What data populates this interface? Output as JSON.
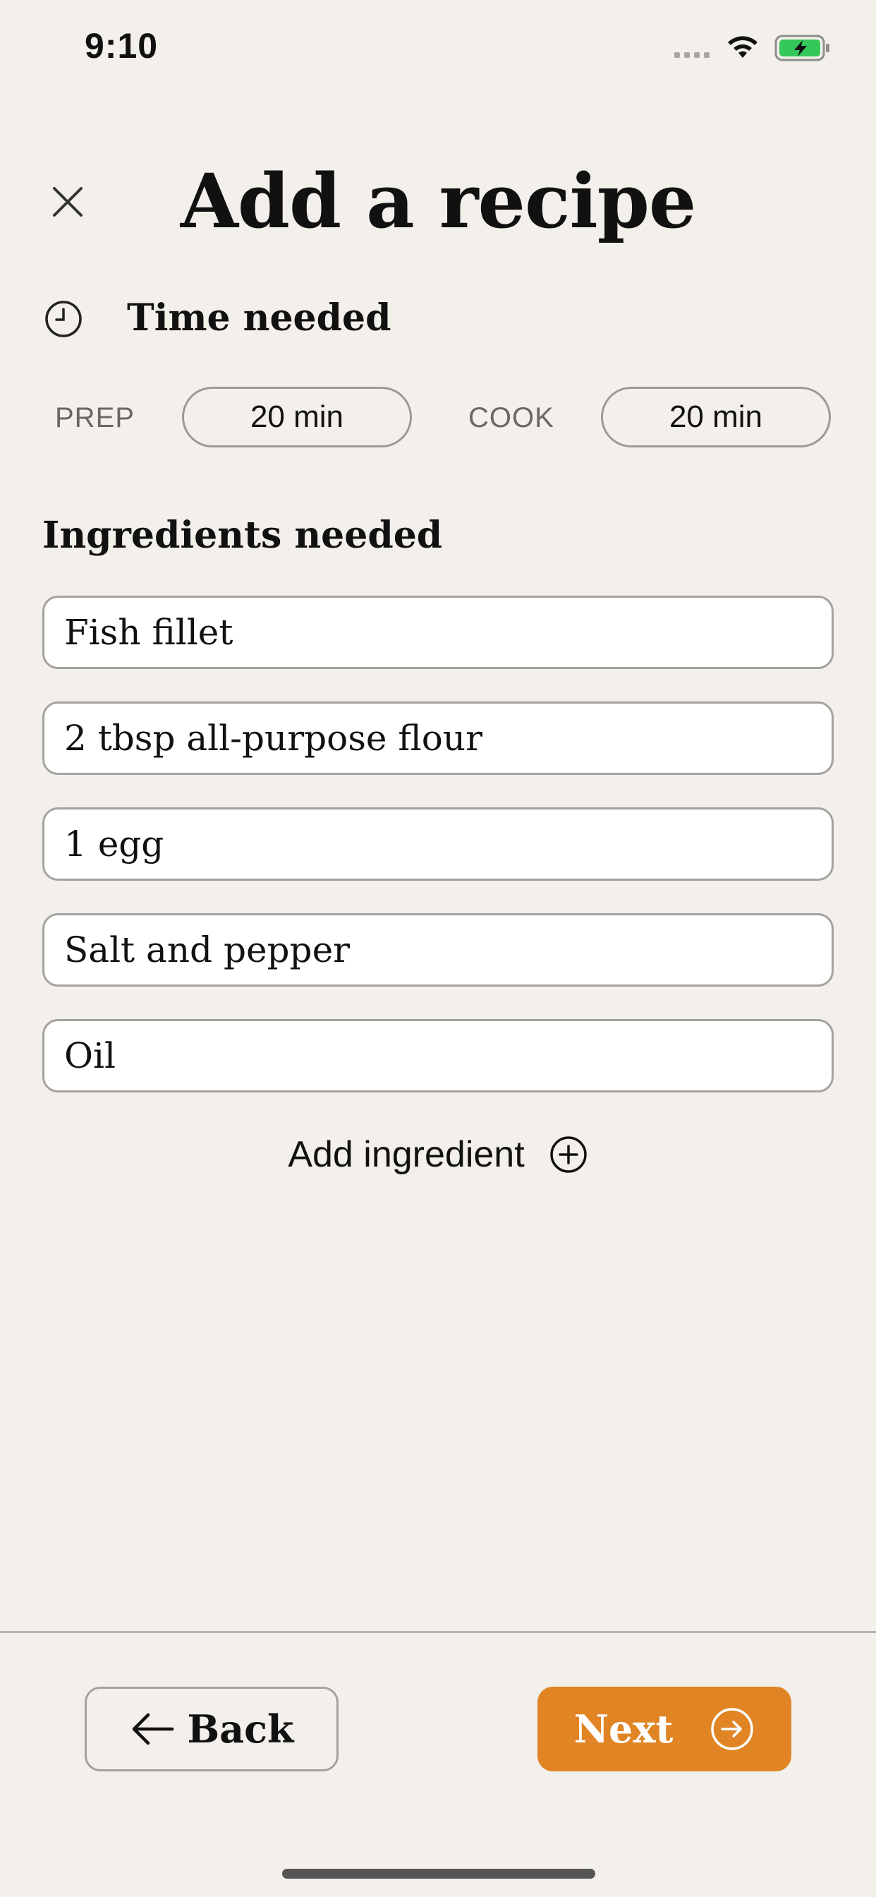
{
  "status_bar": {
    "time": "9:10",
    "icons": [
      "signal-dots-icon",
      "wifi-icon",
      "battery-charging-icon"
    ]
  },
  "header": {
    "title": "Add a recipe",
    "close_icon": "close-icon"
  },
  "time_section": {
    "icon": "clock-icon",
    "heading": "Time needed",
    "prep_label": "PREP",
    "prep_value": "20 min",
    "cook_label": "COOK",
    "cook_value": "20 min"
  },
  "ingredients_section": {
    "heading": "Ingredients needed",
    "items": [
      "Fish fillet",
      "2 tbsp all-purpose flour",
      "1 egg",
      "Salt and pepper",
      "Oil"
    ],
    "add_label": "Add ingredient",
    "add_icon": "plus-circle-icon"
  },
  "footer": {
    "back_label": "Back",
    "back_icon": "arrow-left-icon",
    "next_label": "Next",
    "next_icon": "arrow-right-circle-icon"
  },
  "colors": {
    "background": "#f3f0eb",
    "accent": "#e08424",
    "battery": "#34c759"
  }
}
